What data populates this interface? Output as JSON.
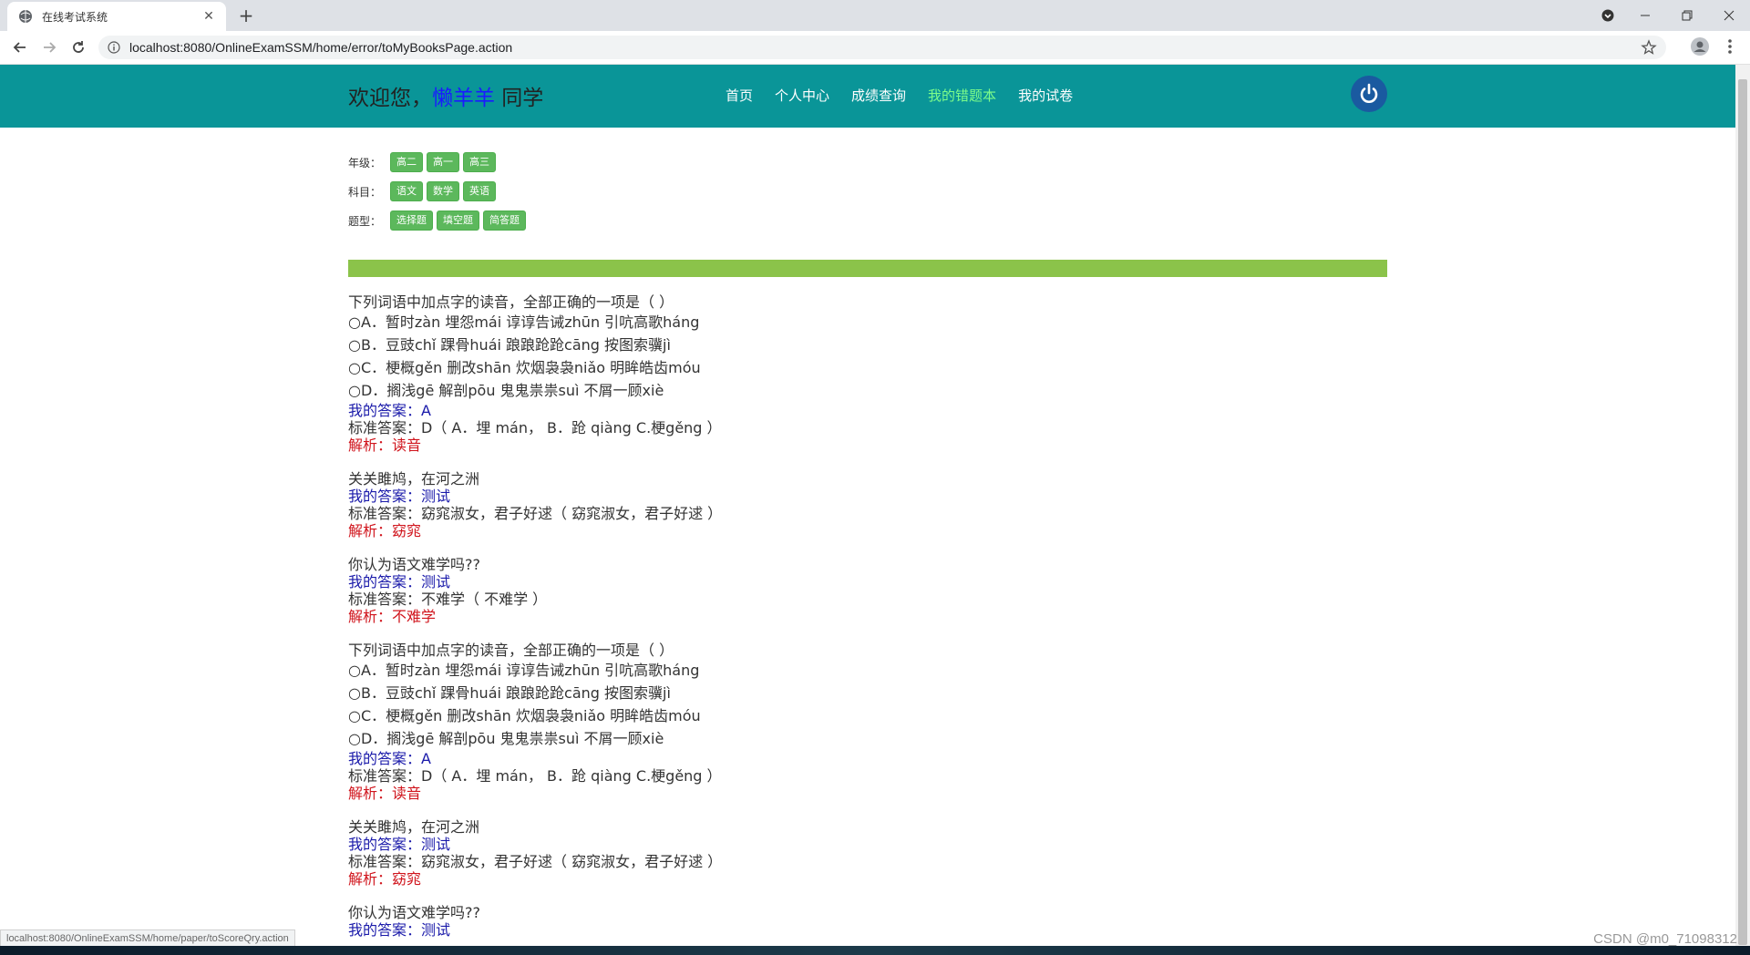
{
  "browser": {
    "tab_title": "在线考试系统",
    "tab_close": "✕",
    "new_tab": "+",
    "url": "localhost:8080/OnlineExamSSM/home/error/toMyBooksPage.action",
    "status_url": "localhost:8080/OnlineExamSSM/home/paper/toScoreQry.action"
  },
  "header": {
    "welcome_prefix": "欢迎您，",
    "username": "懒羊羊",
    "welcome_suffix": " 同学",
    "nav": [
      {
        "label": "首页"
      },
      {
        "label": "个人中心"
      },
      {
        "label": "成绩查询"
      },
      {
        "label": "我的错题本"
      },
      {
        "label": "我的试卷"
      }
    ],
    "active_nav": "我的错题本"
  },
  "filters": {
    "grade": {
      "label": "年级：",
      "options": [
        "高二",
        "高一",
        "高三"
      ]
    },
    "subject": {
      "label": "科目：",
      "options": [
        "语文",
        "数学",
        "英语"
      ]
    },
    "type": {
      "label": "题型：",
      "options": [
        "选择题",
        "填空题",
        "简答题"
      ]
    }
  },
  "questions": [
    {
      "stem": "下列词语中加点字的读音，全部正确的一项是（ ）",
      "options": [
        "○A．暂时zàn 埋怨mái 谆谆告诫zhūn 引吭高歌háng",
        "○B．豆豉chǐ 踝骨huái 踉踉跄跄cāng 按图索骥jì",
        "○C．梗概gěn 删改shān 炊烟袅袅niǎo 明眸皓齿móu",
        "○D．搁浅gē 解剖pōu 鬼鬼祟祟suì 不屑一顾xiè"
      ],
      "mine": "我的答案：A",
      "std": "标准答案：D（ A．埋 mán， B．跄 qiàng C.梗gěng ）",
      "ana": "解析：读音"
    },
    {
      "stem": "关关雎鸠，在河之洲",
      "options": [],
      "mine": "我的答案：测试",
      "std": "标准答案：窈窕淑女，君子好逑（ 窈窕淑女，君子好逑 ）",
      "ana": "解析：窈窕"
    },
    {
      "stem": "你认为语文难学吗??",
      "options": [],
      "mine": "我的答案：测试",
      "std": "标准答案：不难学（ 不难学 ）",
      "ana": "解析：不难学"
    },
    {
      "stem": "下列词语中加点字的读音，全部正确的一项是（ ）",
      "options": [
        "○A．暂时zàn 埋怨mái 谆谆告诫zhūn 引吭高歌háng",
        "○B．豆豉chǐ 踝骨huái 踉踉跄跄cāng 按图索骥jì",
        "○C．梗概gěn 删改shān 炊烟袅袅niǎo 明眸皓齿móu",
        "○D．搁浅gē 解剖pōu 鬼鬼祟祟suì 不屑一顾xiè"
      ],
      "mine": "我的答案：A",
      "std": "标准答案：D（ A．埋 mán， B．跄 qiàng C.梗gěng ）",
      "ana": "解析：读音"
    },
    {
      "stem": "关关雎鸠，在河之洲",
      "options": [],
      "mine": "我的答案：测试",
      "std": "标准答案：窈窕淑女，君子好逑（ 窈窕淑女，君子好逑 ）",
      "ana": "解析：窈窕"
    },
    {
      "stem": "你认为语文难学吗??",
      "options": [],
      "mine": "我的答案：测试",
      "std": "",
      "ana": ""
    }
  ],
  "watermark": "CSDN @m0_71098312",
  "colors": {
    "header_bg": "#0a9598",
    "chip_bg": "#5cb85c",
    "progress": "#8bc34a",
    "active_nav": "#7cfc8a",
    "mine_answer": "#1a1aaa",
    "analysis": "#d0141c"
  }
}
